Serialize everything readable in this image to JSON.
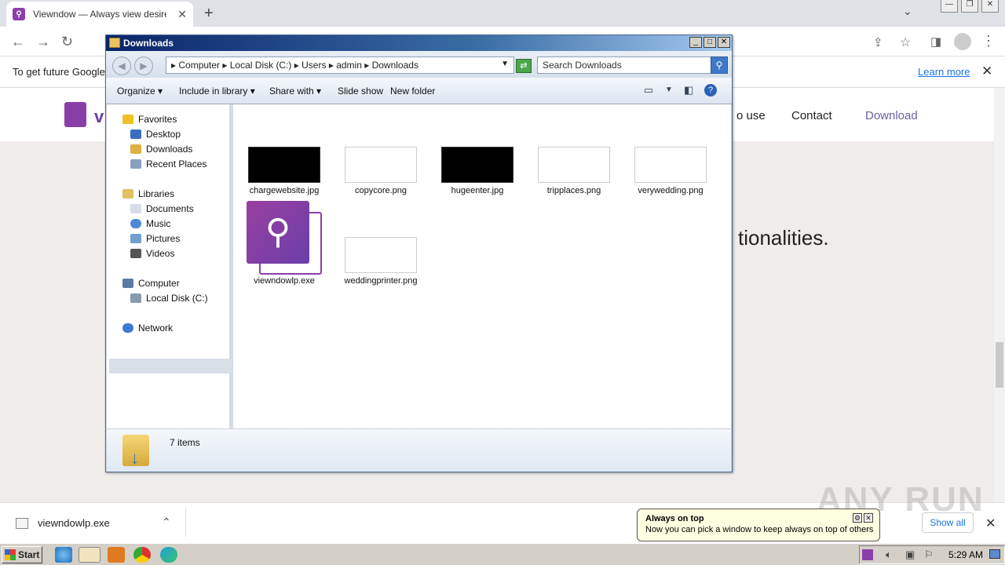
{
  "browser": {
    "tab_title": "Viewndow — Always view desired wi",
    "favicon": "viewndow-icon",
    "new_tab": "+",
    "window_controls": [
      "—",
      "❐",
      "✕"
    ]
  },
  "infobar": {
    "message": "To get future Google",
    "learn_more": "Learn more",
    "close": "✕"
  },
  "site": {
    "logo_text": "v",
    "menu": [
      "o use",
      "Contact",
      "Download"
    ],
    "hero_text": "tionalities."
  },
  "explorer": {
    "title": "Downloads",
    "breadcrumb": [
      "Computer",
      "Local Disk (C:)",
      "Users",
      "admin",
      "Downloads"
    ],
    "search_placeholder": "Search Downloads",
    "toolbar": [
      "Organize",
      "Include in library",
      "Share with",
      "Slide show",
      "New folder"
    ],
    "favorites_header": "Favorites",
    "favorites": [
      "Desktop",
      "Downloads",
      "Recent Places"
    ],
    "libraries_header": "Libraries",
    "libraries": [
      "Documents",
      "Music",
      "Pictures",
      "Videos"
    ],
    "computer_header": "Computer",
    "computer_items": [
      "Local Disk (C:)"
    ],
    "network": "Network",
    "files": [
      {
        "name": "chargewebsite.jpg"
      },
      {
        "name": "copycore.png"
      },
      {
        "name": "hugeenter.jpg"
      },
      {
        "name": "tripplaces.png"
      },
      {
        "name": "verywedding.png"
      },
      {
        "name": "viewndowlp.exe"
      },
      {
        "name": "weddingprinter.png"
      }
    ],
    "status": "7 items"
  },
  "download_bar": {
    "filename": "viewndowlp.exe",
    "show_all": "Show all",
    "close": "✕"
  },
  "tooltip": {
    "title": "Always on top",
    "message": "Now you can pick a window to keep always on top of others"
  },
  "watermark": "ANY RUN",
  "taskbar": {
    "start": "Start",
    "clock": "5:29 AM"
  }
}
